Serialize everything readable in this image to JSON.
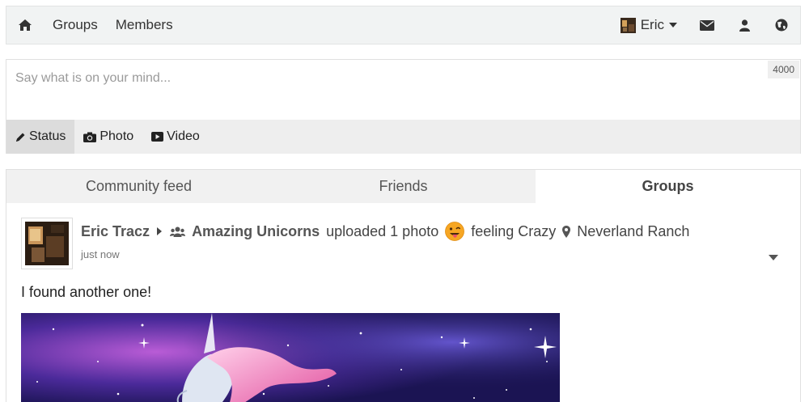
{
  "nav": {
    "home_icon": "home-icon",
    "links": [
      "Groups",
      "Members"
    ],
    "user": {
      "name": "Eric"
    },
    "right_icons": [
      "envelope-icon",
      "user-icon",
      "globe-icon"
    ]
  },
  "composer": {
    "placeholder": "Say what is on your mind...",
    "char_count": "4000",
    "tabs": [
      {
        "label": "Status",
        "icon": "pencil-icon",
        "active": true
      },
      {
        "label": "Photo",
        "icon": "camera-icon",
        "active": false
      },
      {
        "label": "Video",
        "icon": "video-icon",
        "active": false
      }
    ]
  },
  "feed": {
    "tabs": [
      {
        "label": "Community feed",
        "active": false
      },
      {
        "label": "Friends",
        "active": false
      },
      {
        "label": "Groups",
        "active": true
      }
    ],
    "post": {
      "author": "Eric Tracz",
      "group": "Amazing Unicorns",
      "action": "uploaded 1 photo",
      "feeling": "feeling Crazy",
      "location": "Neverland Ranch",
      "time": "just now",
      "text": "I found another one!"
    }
  },
  "colors": {
    "topbar_bg": "#f1f3f3",
    "tab_bg": "#f1f1f1",
    "composer_tabs_bg": "#eeeeee"
  }
}
